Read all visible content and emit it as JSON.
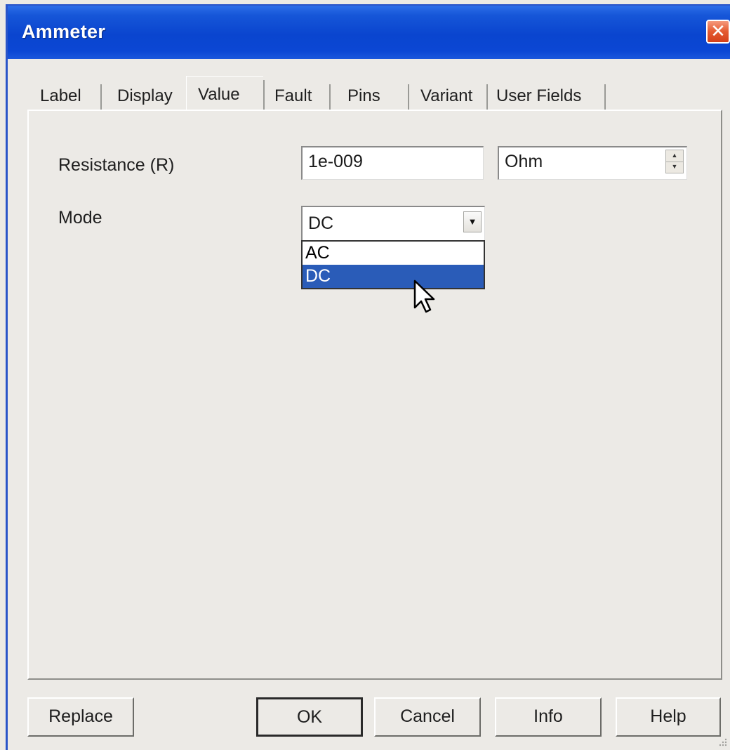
{
  "window": {
    "title": "Ammeter",
    "close_label": "✕"
  },
  "tabs": [
    {
      "label": "Label"
    },
    {
      "label": "Display"
    },
    {
      "label": "Value"
    },
    {
      "label": "Fault"
    },
    {
      "label": "Pins"
    },
    {
      "label": "Variant"
    },
    {
      "label": "User Fields"
    }
  ],
  "active_tab": "Value",
  "form": {
    "resistance_label": "Resistance (R)",
    "resistance_value": "1e-009",
    "unit_value": "Ohm",
    "mode_label": "Mode",
    "mode_value": "DC",
    "mode_options": [
      "AC",
      "DC"
    ],
    "mode_highlighted": "DC"
  },
  "buttons": {
    "replace": "Replace",
    "ok": "OK",
    "cancel": "Cancel",
    "info": "Info",
    "help": "Help"
  },
  "icons": {
    "close": "close-icon",
    "dropdown": "chevron-down-icon",
    "spinner_up": "arrow-up-icon",
    "spinner_down": "arrow-down-icon",
    "cursor": "mouse-pointer-icon"
  },
  "colors": {
    "titlebar": "#0a45cf",
    "selection": "#2a5cb8",
    "close_button": "#e45a30"
  }
}
